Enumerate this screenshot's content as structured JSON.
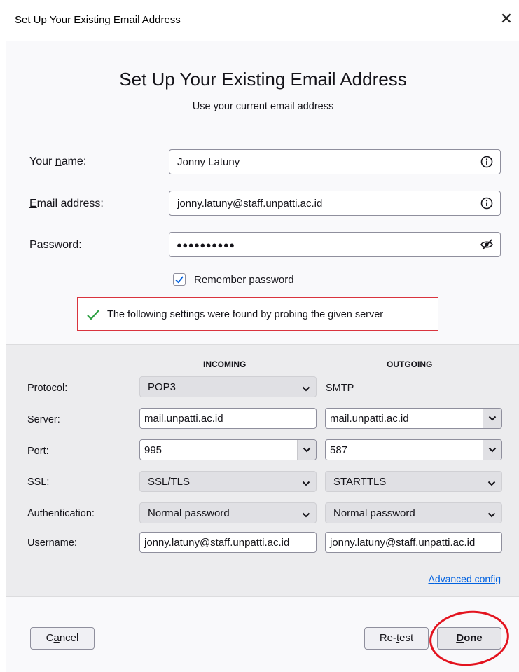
{
  "window": {
    "title": "Set Up Your Existing Email Address",
    "close_glyph": "✕"
  },
  "header": {
    "title": "Set Up Your Existing Email Address",
    "subtitle": "Use your current email address"
  },
  "form": {
    "name": {
      "label_pre": "Your ",
      "label_accel": "n",
      "label_post": "ame:",
      "value": "Jonny Latuny"
    },
    "email": {
      "label_accel": "E",
      "label_post": "mail address:",
      "value": "jonny.latuny@staff.unpatti.ac.id"
    },
    "password": {
      "label_accel": "P",
      "label_post": "assword:",
      "masked": "●●●●●●●●●●"
    },
    "remember": {
      "checked": true,
      "label_pre": "Re",
      "label_accel": "m",
      "label_post": "ember password"
    }
  },
  "notice": {
    "text": "The following settings were found by probing the given server",
    "color": "#2ea043"
  },
  "config": {
    "incoming_header": "INCOMING",
    "outgoing_header": "OUTGOING",
    "rows": {
      "protocol": {
        "label": "Protocol:",
        "incoming": "POP3",
        "outgoing": "SMTP"
      },
      "server": {
        "label": "Server:",
        "incoming": "mail.unpatti.ac.id",
        "outgoing": "mail.unpatti.ac.id"
      },
      "port": {
        "label": "Port:",
        "incoming": "995",
        "outgoing": "587"
      },
      "ssl": {
        "label": "SSL:",
        "incoming": "SSL/TLS",
        "outgoing": "STARTTLS"
      },
      "auth": {
        "label": "Authentication:",
        "incoming": "Normal password",
        "outgoing": "Normal password"
      },
      "username": {
        "label": "Username:",
        "incoming": "jonny.latuny@staff.unpatti.ac.id",
        "outgoing": "jonny.latuny@staff.unpatti.ac.id"
      }
    },
    "advanced": {
      "accel": "A",
      "rest": "dvanced config"
    }
  },
  "buttons": {
    "cancel": {
      "pre": "C",
      "accel": "a",
      "post": "ncel"
    },
    "retest": {
      "pre": "Re-",
      "accel": "t",
      "post": "est"
    },
    "done": {
      "pre": "",
      "accel": "D",
      "post": "one"
    }
  },
  "colors": {
    "accent": "#0061e0",
    "highlight_circle": "#e3141f",
    "notice_border": "#d9343e"
  },
  "icons": {
    "info": "info-circle-icon",
    "eye": "eye-slash-icon",
    "check": "checkmark-icon",
    "chevron": "chevron-down-icon",
    "close": "close-icon"
  }
}
